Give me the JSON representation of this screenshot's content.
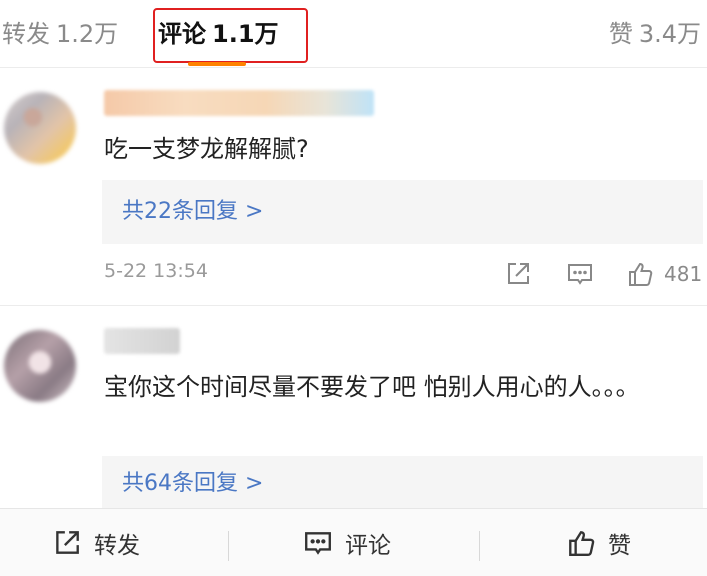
{
  "tabs": {
    "repost": {
      "label": "转发",
      "count": "1.2万"
    },
    "comment": {
      "label": "评论",
      "count": "1.1万"
    },
    "like": {
      "label": "赞",
      "count": "3.4万"
    }
  },
  "comments": [
    {
      "text": "吃一支梦龙解解腻?",
      "reply_summary": "共22条回复 >",
      "time": "5-22 13:54",
      "like_count": "481"
    },
    {
      "text": "宝你这个时间尽量不要发了吧 怕别人用心的人。。。",
      "reply_summary": "共64条回复 >"
    }
  ],
  "bottom_bar": {
    "repost_label": "转发",
    "comment_label": "评论",
    "like_label": "赞"
  },
  "colors": {
    "accent_orange": "#ff8200",
    "link_blue": "#4a77c4",
    "highlight_red": "#e02020"
  },
  "icons": [
    "share-icon",
    "comment-icon",
    "thumbs-up-icon"
  ]
}
